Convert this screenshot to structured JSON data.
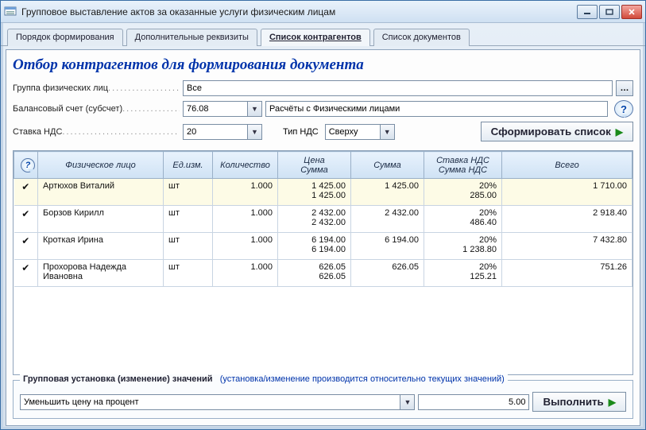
{
  "window": {
    "title": "Групповое выставление актов за оказанные услуги физическим лицам"
  },
  "tabs": {
    "t0": "Порядок формирования",
    "t1": "Дополнительные реквизиты",
    "t2": "Список контрагентов",
    "t3": "Список документов"
  },
  "section_title": "Отбор контрагентов для формирования документа",
  "labels": {
    "group": "Группа физических лиц",
    "account": "Балансовый счет (субсчет)",
    "vat_rate": "Ставка НДС",
    "vat_type": "Тип НДС"
  },
  "fields": {
    "group_value": "Все",
    "account_code": "76.08",
    "account_text": "Расчёты с Физическими лицами",
    "vat_rate": "20",
    "vat_type": "Сверху"
  },
  "buttons": {
    "form_list": "Сформировать список",
    "execute": "Выполнить"
  },
  "grid": {
    "headers": {
      "person": "Физическое лицо",
      "unit": "Ед.изм.",
      "qty": "Количество",
      "price": "Цена",
      "price2": "Сумма",
      "sum": "Сумма",
      "vat_rate": "Ставка НДС",
      "vat_sum": "Сумма НДС",
      "total": "Всего"
    },
    "rows": [
      {
        "person": "Артюхов Виталий",
        "unit": "шт",
        "qty": "1.000",
        "price": "1 425.00",
        "price2": "1 425.00",
        "sum": "1 425.00",
        "vat_rate": "20%",
        "vat_sum": "285.00",
        "total": "1 710.00"
      },
      {
        "person": "Борзов Кирилл",
        "unit": "шт",
        "qty": "1.000",
        "price": "2 432.00",
        "price2": "2 432.00",
        "sum": "2 432.00",
        "vat_rate": "20%",
        "vat_sum": "486.40",
        "total": "2 918.40"
      },
      {
        "person": "Кроткая Ирина",
        "unit": "шт",
        "qty": "1.000",
        "price": "6 194.00",
        "price2": "6 194.00",
        "sum": "6 194.00",
        "vat_rate": "20%",
        "vat_sum": "1 238.80",
        "total": "7 432.80"
      },
      {
        "person": "Прохорова Надежда Ивановна",
        "unit": "шт",
        "qty": "1.000",
        "price": "626.05",
        "price2": "626.05",
        "sum": "626.05",
        "vat_rate": "20%",
        "vat_sum": "125.21",
        "total": "751.26"
      }
    ]
  },
  "group_edit": {
    "legend": "Групповая установка (изменение) значений",
    "hint": "(установка/изменение производится относительно текущих значений)",
    "mode": "Уменьшить цену на процент",
    "value": "5.00"
  }
}
